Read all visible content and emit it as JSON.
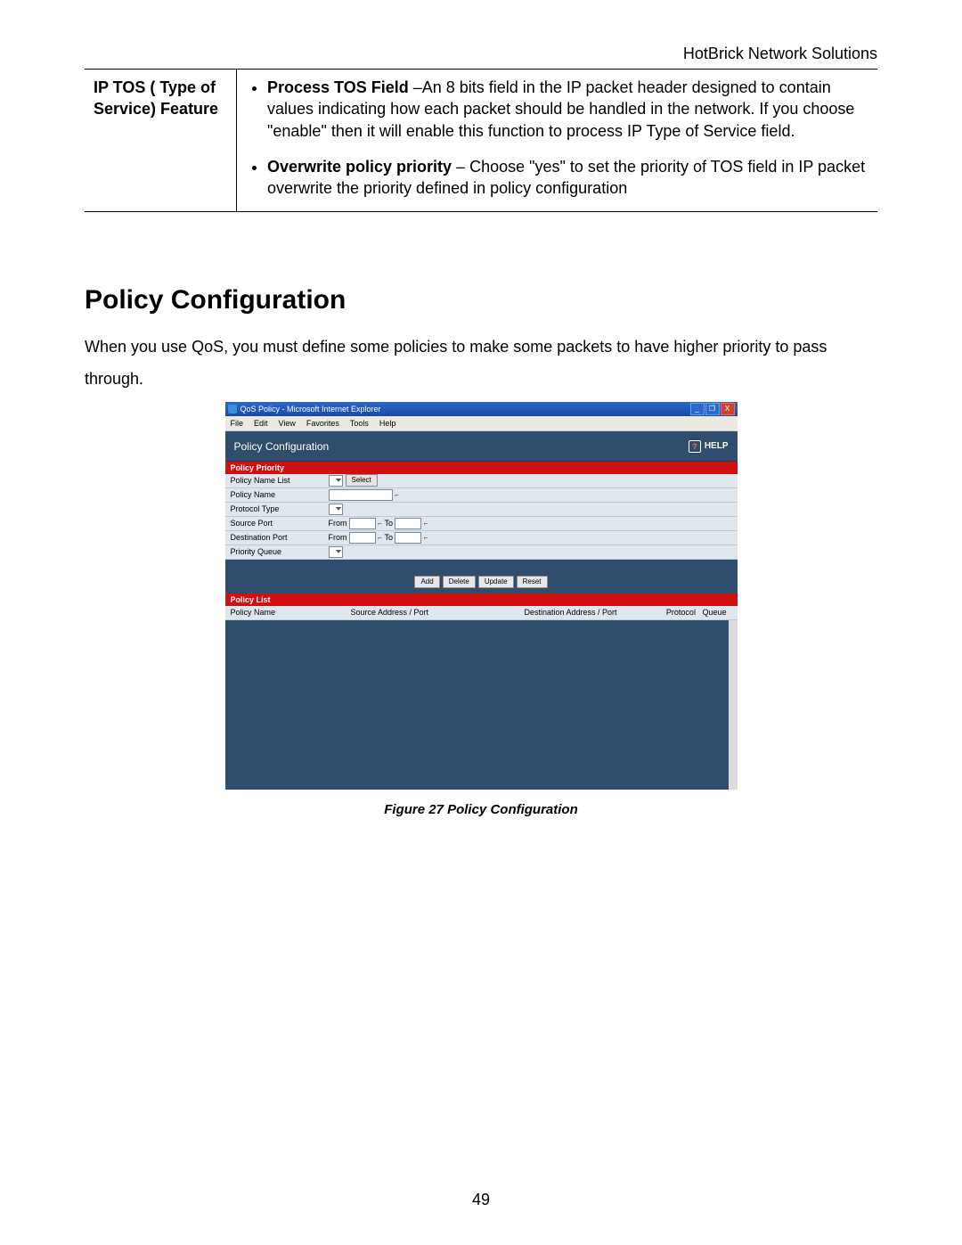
{
  "doc": {
    "header_right": "HotBrick Network Solutions",
    "page_number": "49"
  },
  "feature_table": {
    "left_heading": "IP TOS ( Type of Service) Feature",
    "item1_title": "Process TOS Field",
    "item1_body": " –An 8 bits field in the IP packet header designed to contain values indicating how each packet should be handled in the network. If you choose \"enable\" then it will enable this function to process IP Type of Service field.",
    "item2_title": "Overwrite policy priority",
    "item2_body": " – Choose \"yes\" to set the priority of TOS field in IP packet overwrite the priority defined in policy configuration"
  },
  "section": {
    "heading": "Policy Configuration",
    "intro": "When you use QoS, you must define some policies to make some packets to have higher priority to pass through."
  },
  "screenshot": {
    "window_title": "QoS Policy - Microsoft Internet Explorer",
    "menus": [
      "File",
      "Edit",
      "View",
      "Favorites",
      "Tools",
      "Help"
    ],
    "panel_title": "Policy Configuration",
    "help_label": "HELP",
    "priority_band": "Policy Priority",
    "rows": {
      "r1_label": "Policy Name List",
      "r1_btn": "Select",
      "r2_label": "Policy Name",
      "r3_label": "Protocol Type",
      "r4_label": "Source Port",
      "r5_label": "Destination Port",
      "r6_label": "Priority Queue",
      "from": "From",
      "to": "To"
    },
    "buttons": [
      "Add",
      "Delete",
      "Update",
      "Reset"
    ],
    "list_band": "Policy List",
    "list_cols": [
      "Policy Name",
      "Source Address / Port",
      "Destination Address / Port",
      "Protocol",
      "Queue"
    ]
  },
  "caption": "Figure 27  Policy Configuration"
}
